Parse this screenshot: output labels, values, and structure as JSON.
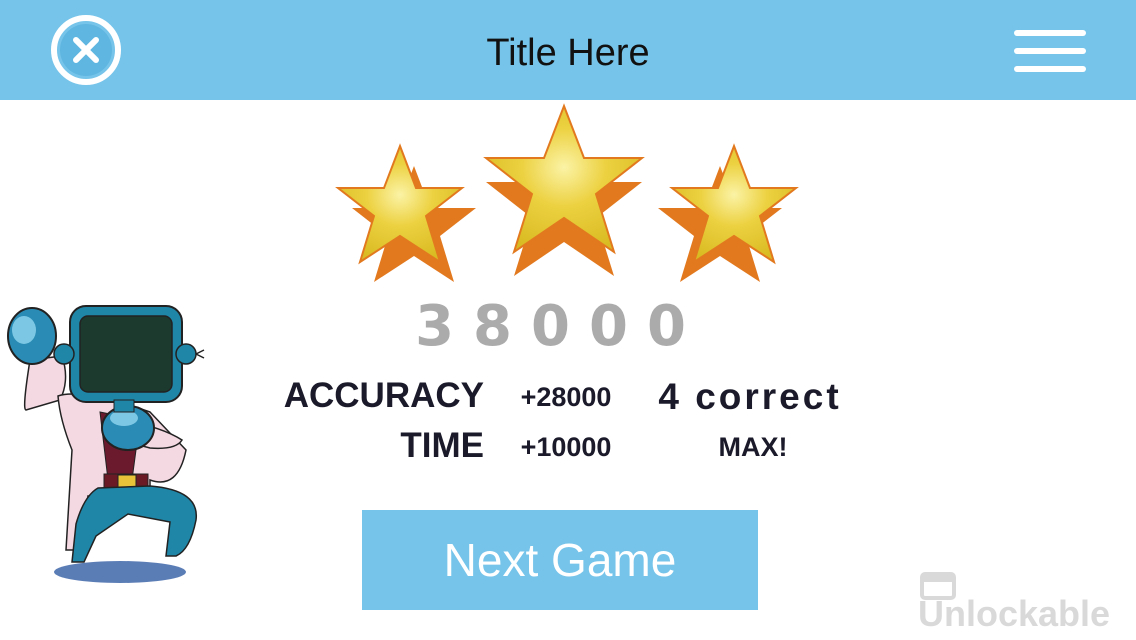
{
  "header": {
    "title": "Title Here",
    "close_icon": "close-icon",
    "menu_icon": "hamburger-menu-icon"
  },
  "results": {
    "stars_earned": 3,
    "stars_total": 3,
    "score": "38000",
    "rows": [
      {
        "label": "ACCURACY",
        "value": "+28000",
        "note": "4 correct"
      },
      {
        "label": "TIME",
        "value": "+10000",
        "note": "MAX!"
      }
    ]
  },
  "actions": {
    "next_label": "Next Game"
  },
  "watermark": {
    "text": "Unlockable"
  },
  "colors": {
    "header_bg": "#76c4ea",
    "button_bg": "#76c4ea",
    "star_face": "#e6c62e",
    "star_side": "#e2791f",
    "score_gray": "#ababab",
    "text_dark": "#1a1a2a"
  }
}
